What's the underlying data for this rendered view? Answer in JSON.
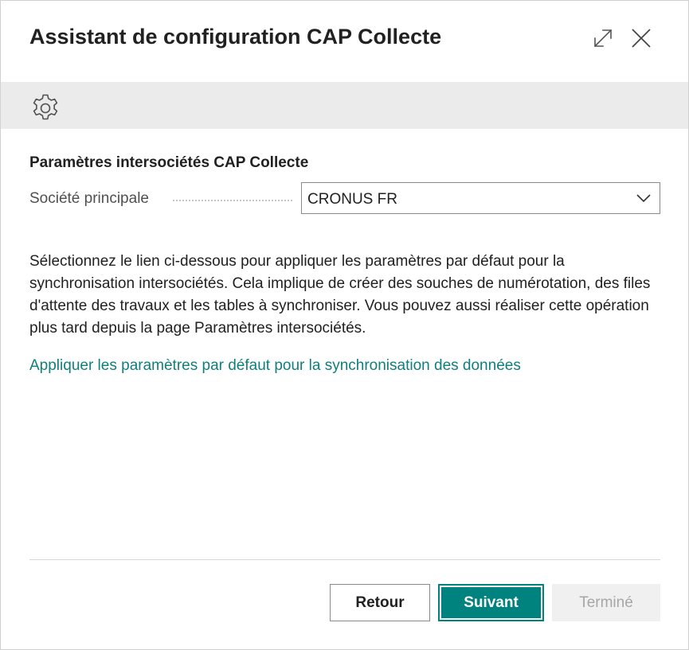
{
  "dialog": {
    "title": "Assistant de configuration CAP Collecte",
    "expand_icon": "expand-icon",
    "close_icon": "close-icon"
  },
  "toolbar": {
    "settings_icon": "gear-icon"
  },
  "section": {
    "title": "Paramètres intersociétés CAP Collecte",
    "field_label": "Société principale",
    "field_value": "CRONUS FR",
    "dropdown_icon": "chevron-down-icon"
  },
  "description": "Sélectionnez le lien ci-dessous pour appliquer les paramètres par défaut pour la synchronisation intersociétés. Cela implique de créer des souches de numérotation, des files d'attente des travaux et les tables à synchroniser. Vous pouvez aussi réaliser cette opération plus tard depuis la page Paramètres intersociétés.",
  "link": "Appliquer les paramètres par défaut pour la synchronisation des données",
  "footer": {
    "back_label": "Retour",
    "next_label": "Suivant",
    "finish_label": "Terminé"
  },
  "colors": {
    "accent": "#00827f",
    "link": "#0f7f7b",
    "toolbar_bg": "#ebebeb",
    "disabled_bg": "#f0f0f0"
  }
}
